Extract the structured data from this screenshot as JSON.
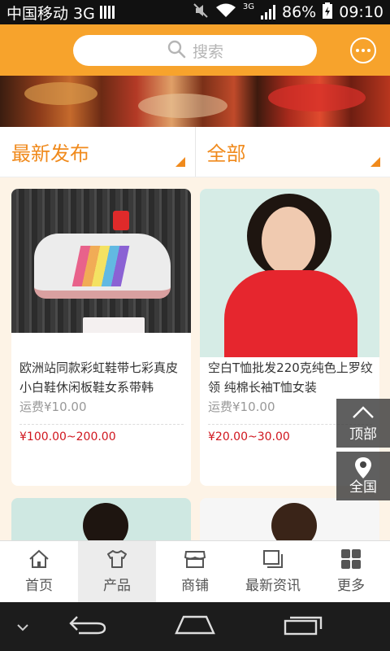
{
  "status_bar": {
    "carrier": "中国移动 3G",
    "network_type": "3G",
    "battery": "86%",
    "time": "09:10"
  },
  "header": {
    "search_placeholder": "搜索"
  },
  "filters": [
    {
      "label": "最新发布"
    },
    {
      "label": "全部"
    }
  ],
  "products": [
    {
      "title": "欧洲站同款彩虹鞋带七彩真皮小白鞋休闲板鞋女系带韩",
      "shipping": "运费¥10.00",
      "price": "¥100.00~200.00"
    },
    {
      "title": "空白T恤批发220克纯色上罗纹领 纯棉长袖T恤女装",
      "shipping": "运费¥10.00",
      "price": "¥20.00~30.00"
    }
  ],
  "side_buttons": {
    "top": "顶部",
    "nationwide": "全国"
  },
  "tabs": [
    {
      "label": "首页",
      "icon": "home-icon"
    },
    {
      "label": "产品",
      "icon": "tshirt-icon",
      "active": true
    },
    {
      "label": "商铺",
      "icon": "shop-icon"
    },
    {
      "label": "最新资讯",
      "icon": "news-icon"
    },
    {
      "label": "更多",
      "icon": "grid-icon"
    }
  ],
  "colors": {
    "accent": "#f7a32c",
    "filter_text": "#f08a1c",
    "price": "#d0161e"
  }
}
